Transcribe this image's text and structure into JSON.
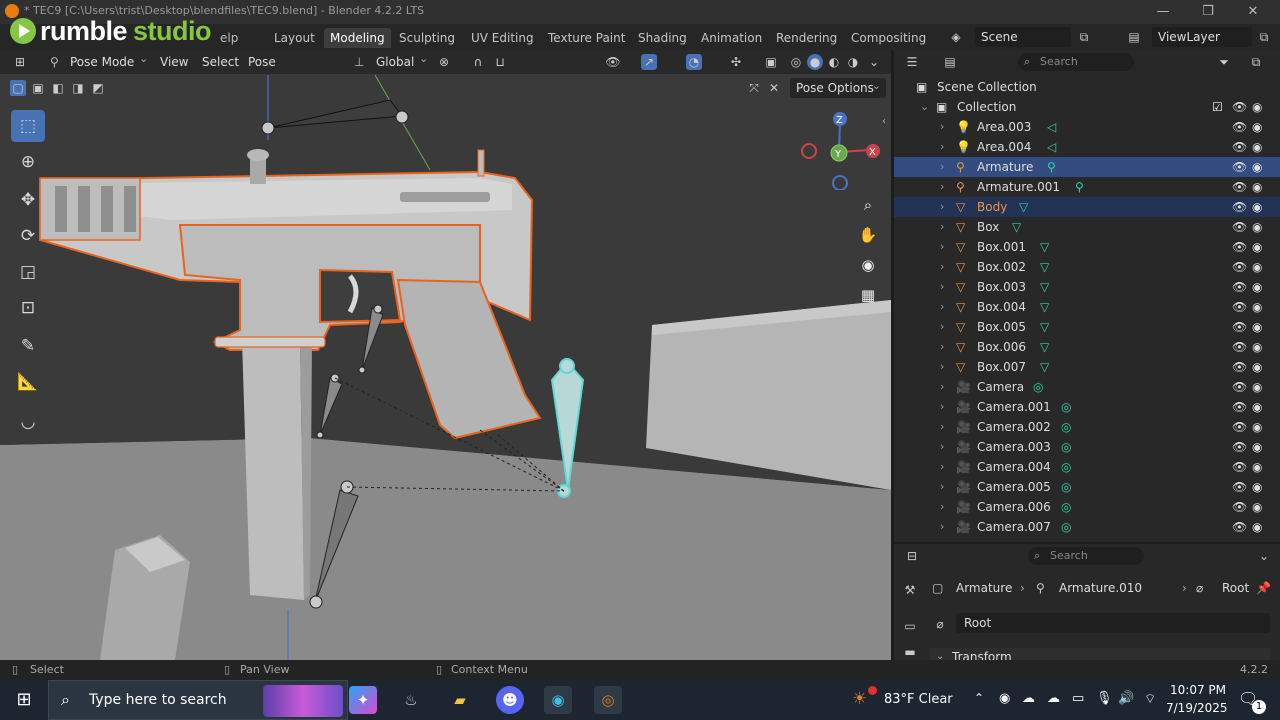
{
  "window": {
    "title": "* TEC9 [C:\\Users\\trist\\Desktop\\blendfiles\\TEC9.blend] - Blender 4.2.2 LTS",
    "minimize": "—",
    "restore": "❐",
    "close": "✕"
  },
  "overlay": {
    "brand_a": "rumble",
    "brand_b": "studio"
  },
  "menu": {
    "file_hint": "elp"
  },
  "workspaces": [
    {
      "label": "Layout",
      "active": false
    },
    {
      "label": "Modeling",
      "active": true
    },
    {
      "label": "Sculpting",
      "active": false
    },
    {
      "label": "UV Editing",
      "active": false
    },
    {
      "label": "Texture Paint",
      "active": false
    },
    {
      "label": "Shading",
      "active": false
    },
    {
      "label": "Animation",
      "active": false
    },
    {
      "label": "Rendering",
      "active": false
    },
    {
      "label": "Compositing",
      "active": false
    }
  ],
  "scene": {
    "name": "Scene",
    "view_layer": "ViewLayer"
  },
  "viewport_header": {
    "mode": "Pose Mode",
    "view": "View",
    "select": "Select",
    "pose": "Pose",
    "orientation": "Global",
    "pose_options": "Pose Options"
  },
  "gizmo": {
    "z": "Z",
    "y": "Y",
    "x": "X"
  },
  "outliner": {
    "search_placeholder": "Search",
    "scene_collection": "Scene Collection",
    "collection": "Collection",
    "rows": [
      {
        "name": "Area.003",
        "type": "light"
      },
      {
        "name": "Area.004",
        "type": "light"
      },
      {
        "name": "Armature",
        "type": "armature",
        "selected": true
      },
      {
        "name": "Armature.001",
        "type": "armature"
      },
      {
        "name": "Body",
        "type": "mesh",
        "active": true
      },
      {
        "name": "Box",
        "type": "mesh"
      },
      {
        "name": "Box.001",
        "type": "mesh"
      },
      {
        "name": "Box.002",
        "type": "mesh"
      },
      {
        "name": "Box.003",
        "type": "mesh"
      },
      {
        "name": "Box.004",
        "type": "mesh"
      },
      {
        "name": "Box.005",
        "type": "mesh"
      },
      {
        "name": "Box.006",
        "type": "mesh"
      },
      {
        "name": "Box.007",
        "type": "mesh"
      },
      {
        "name": "Camera",
        "type": "camera"
      },
      {
        "name": "Camera.001",
        "type": "camera"
      },
      {
        "name": "Camera.002",
        "type": "camera"
      },
      {
        "name": "Camera.003",
        "type": "camera"
      },
      {
        "name": "Camera.004",
        "type": "camera"
      },
      {
        "name": "Camera.005",
        "type": "camera"
      },
      {
        "name": "Camera.006",
        "type": "camera"
      },
      {
        "name": "Camera.007",
        "type": "camera"
      }
    ]
  },
  "properties": {
    "search_placeholder": "Search",
    "breadcrumb": [
      "Armature",
      "Armature.010",
      "Root"
    ],
    "bone_name": "Root",
    "section": "Transform"
  },
  "statusbar": {
    "select": "Select",
    "pan": "Pan View",
    "context": "Context Menu",
    "version": "4.2.2"
  },
  "taskbar": {
    "search_placeholder": "Type here to search",
    "weather": "83°F  Clear",
    "time": "10:07 PM",
    "date": "7/19/2025",
    "notification_count": "1"
  },
  "colors": {
    "accent": "#4772b3",
    "selection_outline": "#e8631e",
    "bone_active": "#5fd8d6",
    "brand": "#85c742"
  }
}
